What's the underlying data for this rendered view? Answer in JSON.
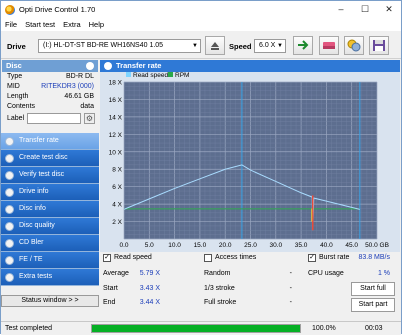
{
  "window": {
    "title": "Opti Drive Control 1.70",
    "minimize": "–",
    "maximize": "☐",
    "close": "✕"
  },
  "menu": [
    {
      "label": "File"
    },
    {
      "label": "Start test"
    },
    {
      "label": "Extra"
    },
    {
      "label": "Help"
    }
  ],
  "drivebar": {
    "drive_label": "Drive",
    "drive_value": "(I:)  HL-DT-ST BD-RE  WH16NS40 1.05",
    "speed_label": "Speed",
    "speed_value": "6.0 X"
  },
  "disc": {
    "header": "Disc",
    "rows": [
      {
        "key": "Type",
        "value": "BD-R DL",
        "blue": false
      },
      {
        "key": "MID",
        "value": "RITEKDR3 (000)",
        "blue": true
      },
      {
        "key": "Length",
        "value": "46.61 GB",
        "blue": false
      },
      {
        "key": "Contents",
        "value": "data",
        "blue": false
      }
    ],
    "label_key": "Label",
    "label_value": ""
  },
  "nav": [
    {
      "label": "Transfer rate",
      "active": true
    },
    {
      "label": "Create test disc",
      "active": false
    },
    {
      "label": "Verify test disc",
      "active": false
    },
    {
      "label": "Drive info",
      "active": false
    },
    {
      "label": "Disc info",
      "active": false
    },
    {
      "label": "Disc quality",
      "active": false
    },
    {
      "label": "CD Bler",
      "active": false
    },
    {
      "label": "FE / TE",
      "active": false
    },
    {
      "label": "Extra tests",
      "active": false
    }
  ],
  "status_window": "Status window > >",
  "panel": {
    "title": "Transfer rate"
  },
  "chart_data": {
    "type": "line",
    "legend": [
      "Read speed",
      "RPM"
    ],
    "legend_colors": [
      "#7fd4ff",
      "#2aa84a"
    ],
    "x_ticks": [
      "0.0",
      "5.0",
      "10.0",
      "15.0",
      "20.0",
      "25.0",
      "30.0",
      "35.0",
      "40.0",
      "45.0",
      "50.0 GB"
    ],
    "y_ticks": [
      "2 X",
      "4 X",
      "6 X",
      "8 X",
      "10 X",
      "12 X",
      "14 X",
      "16 X",
      "18 X"
    ],
    "xlim": [
      0,
      50
    ],
    "ylim": [
      0,
      18
    ],
    "layer_break_gb": 23.3,
    "end_gb": 46.61,
    "series": [
      {
        "name": "Read speed",
        "x": [
          0,
          5,
          10,
          15,
          20,
          23.3,
          25,
          30,
          35,
          37.2,
          37.3,
          37.5,
          46.6
        ],
        "y": [
          3.4,
          4.6,
          5.8,
          6.9,
          8.0,
          8.5,
          7.9,
          6.6,
          5.3,
          4.8,
          1.0,
          4.7,
          3.4
        ]
      },
      {
        "name": "RPM",
        "x": [
          0,
          23.3,
          46.6
        ],
        "y": [
          3.45,
          3.45,
          3.45
        ]
      }
    ]
  },
  "stats": {
    "read_speed_label": "Read speed",
    "access_times_label": "Access times",
    "burst_rate_label": "Burst rate",
    "burst_rate_value": "83.8 MB/s",
    "average_label": "Average",
    "average_value": "5.79 X",
    "start_label": "Start",
    "start_value": "3.43 X",
    "end_label": "End",
    "end_value": "3.44 X",
    "random_label": "Random",
    "random_value": "-",
    "one_third_label": "1/3 stroke",
    "one_third_value": "-",
    "full_stroke_label": "Full stroke",
    "full_stroke_value": "-",
    "cpu_label": "CPU usage",
    "cpu_value": "1 %",
    "start_full_button": "Start full",
    "start_part_button": "Start part"
  },
  "status": {
    "text": "Test completed",
    "progress": 1.0,
    "percent": "100.0%",
    "time": "00:03"
  }
}
